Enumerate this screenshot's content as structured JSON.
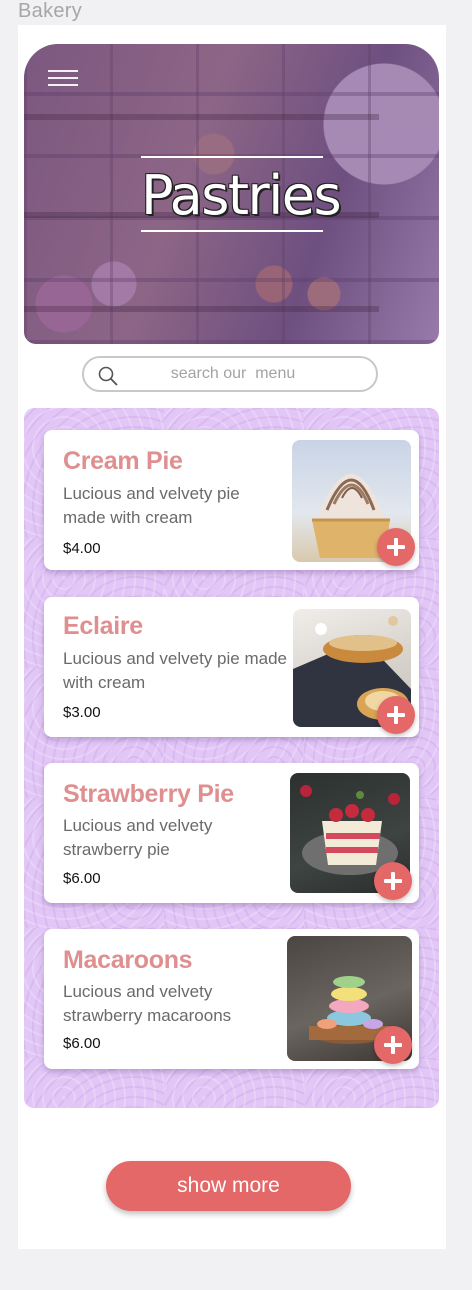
{
  "frame_label": "Bakery",
  "hero": {
    "title": "Pastries",
    "menu_icon": "hamburger-menu-icon"
  },
  "search": {
    "placeholder": "search our  menu",
    "icon": "search-icon"
  },
  "items": [
    {
      "name": "Cream Pie",
      "desc_line1": "Lucious and velvety pie",
      "desc_line2": "made with cream",
      "price": "$4.00"
    },
    {
      "name": "Eclaire",
      "desc_line1": "Lucious and velvety pie made",
      "desc_line2": "with cream",
      "price": "$3.00"
    },
    {
      "name": "Strawberry Pie",
      "desc_line1": "Lucious and velvety",
      "desc_line2": "strawberry pie",
      "price": "$6.00"
    },
    {
      "name": "Macaroons",
      "desc_line1": "Lucious and velvety",
      "desc_line2": "strawberry macaroons",
      "price": "$6.00"
    }
  ],
  "show_more_label": "show more",
  "colors": {
    "accent": "#e46868",
    "title": "#df8f8f",
    "panel": "#e1c6f6",
    "hero_overlay": "#70488c"
  }
}
